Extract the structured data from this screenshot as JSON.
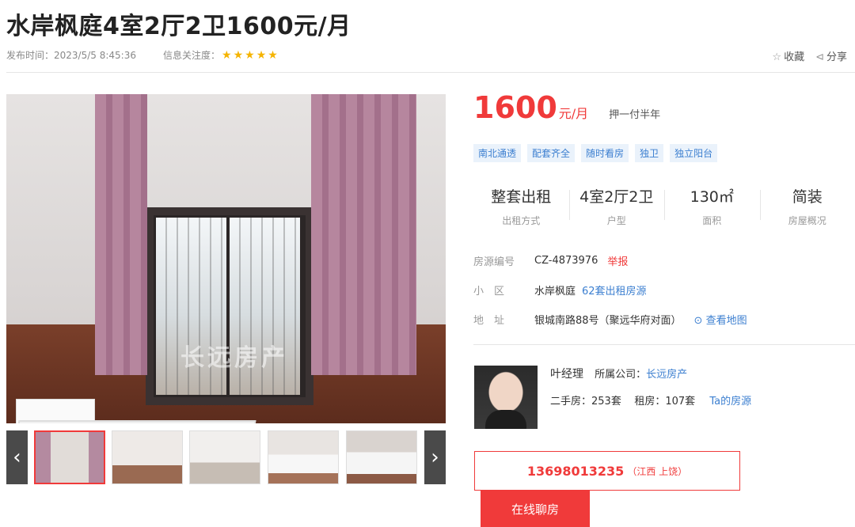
{
  "title": "水岸枫庭4室2厅2卫1600元/月",
  "meta": {
    "publish_label": "发布时间：",
    "publish_time": "2023/5/5 8:45:36",
    "attention_label": "信息关注度：",
    "stars": 5
  },
  "actions": {
    "favorite": "收藏",
    "share": "分享"
  },
  "gallery": {
    "watermark": "长远房产",
    "prev_icon": "chevron-left-icon",
    "next_icon": "chevron-right-icon",
    "thumb_count": 5,
    "active_thumb": 1
  },
  "price": {
    "value": "1600",
    "unit": "元/月",
    "payment": "押一付半年"
  },
  "tags": [
    "南北通透",
    "配套齐全",
    "随时看房",
    "独卫",
    "独立阳台"
  ],
  "stats": [
    {
      "value": "整套出租",
      "label": "出租方式"
    },
    {
      "value": "4室2厅2卫",
      "label": "户型"
    },
    {
      "value": "130㎡",
      "label": "面积"
    },
    {
      "value": "简装",
      "label": "房屋概况"
    }
  ],
  "details": {
    "code_label": "房源编号",
    "code": "CZ-4873976",
    "report": "举报",
    "community_label": "小　区",
    "community": "水岸枫庭",
    "community_link": "62套出租房源",
    "address_label": "地　址",
    "address": "银城南路88号（聚远华府对面）",
    "map_link": "查看地图"
  },
  "agent": {
    "name": "叶经理",
    "company_label": "所属公司：",
    "company": "长远房产",
    "second_hand": "二手房：253套",
    "rent": "租房：107套",
    "listings_link": "Ta的房源"
  },
  "contact": {
    "phone": "13698013235",
    "location": "（江西 上饶）",
    "chat": "在线聊房"
  },
  "colors": {
    "accent": "#f03a3a",
    "link": "#3c7fd0",
    "star": "#f5b400"
  }
}
